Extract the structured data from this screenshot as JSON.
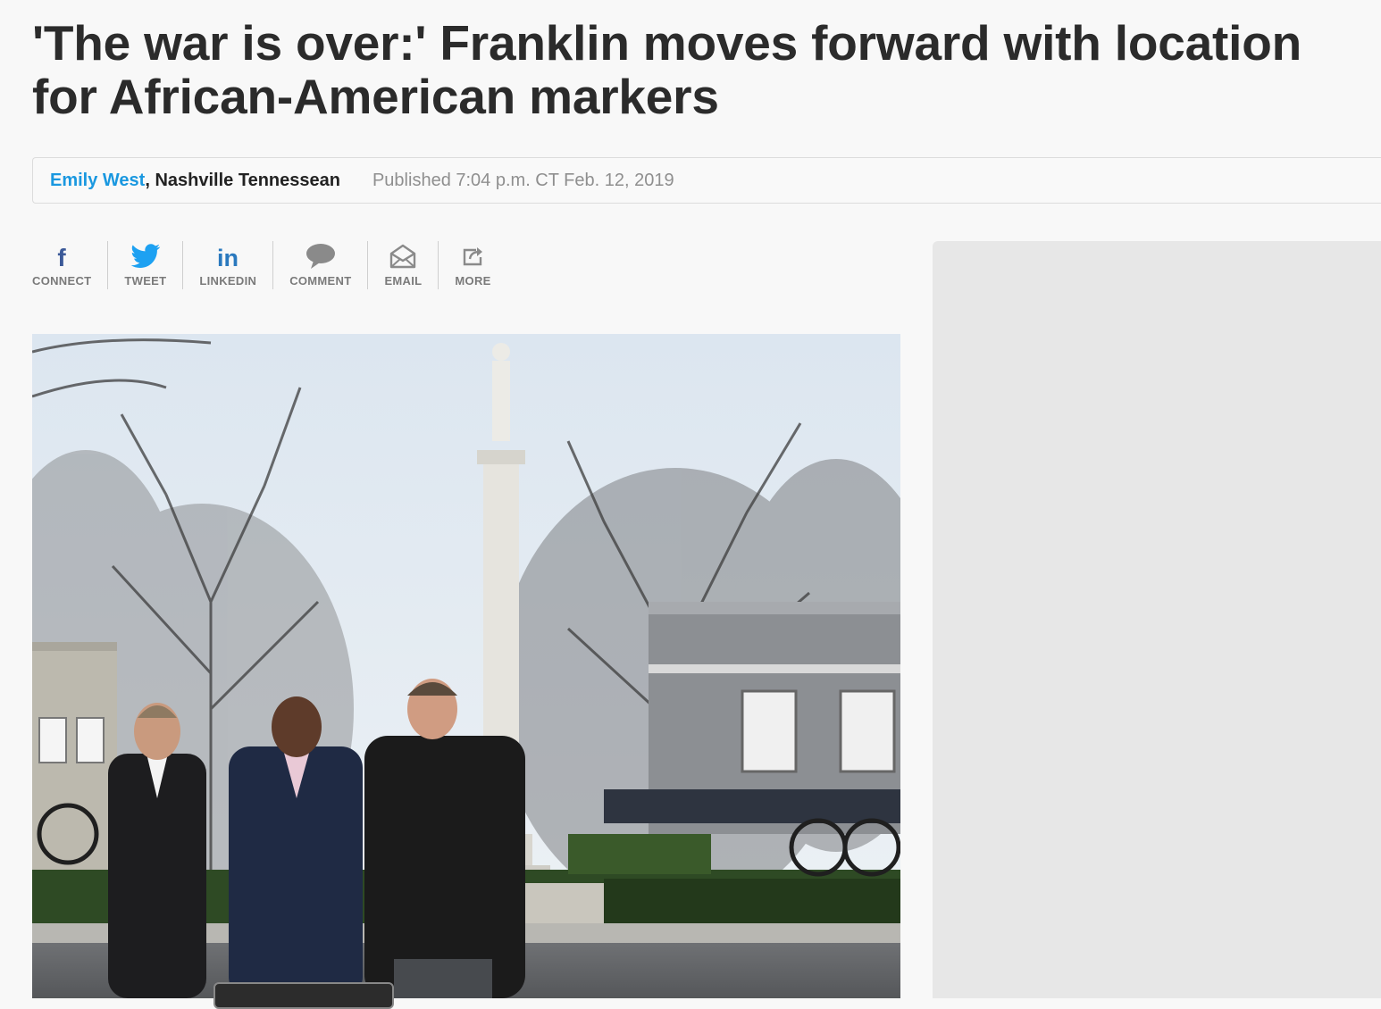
{
  "article": {
    "headline_line1": "'The war is over:' Franklin moves forward with location",
    "headline_line2": "for African-American markers"
  },
  "byline": {
    "author": "Emily West",
    "separator": ", ",
    "organization": "Nashville Tennessean",
    "published": "Published 7:04 p.m. CT Feb. 12, 2019"
  },
  "share": [
    {
      "label": "CONNECT",
      "icon": "facebook-icon"
    },
    {
      "label": "TWEET",
      "icon": "twitter-icon"
    },
    {
      "label": "LINKEDIN",
      "icon": "linkedin-icon"
    },
    {
      "label": "COMMENT",
      "icon": "comment-icon"
    },
    {
      "label": "EMAIL",
      "icon": "email-icon"
    },
    {
      "label": "MORE",
      "icon": "share-icon"
    }
  ],
  "colors": {
    "author_link": "#1a98e0",
    "facebook": "#3b5998",
    "twitter": "#1da1f2",
    "linkedin": "#2a79be",
    "icon_gray": "#8a8a8a"
  }
}
